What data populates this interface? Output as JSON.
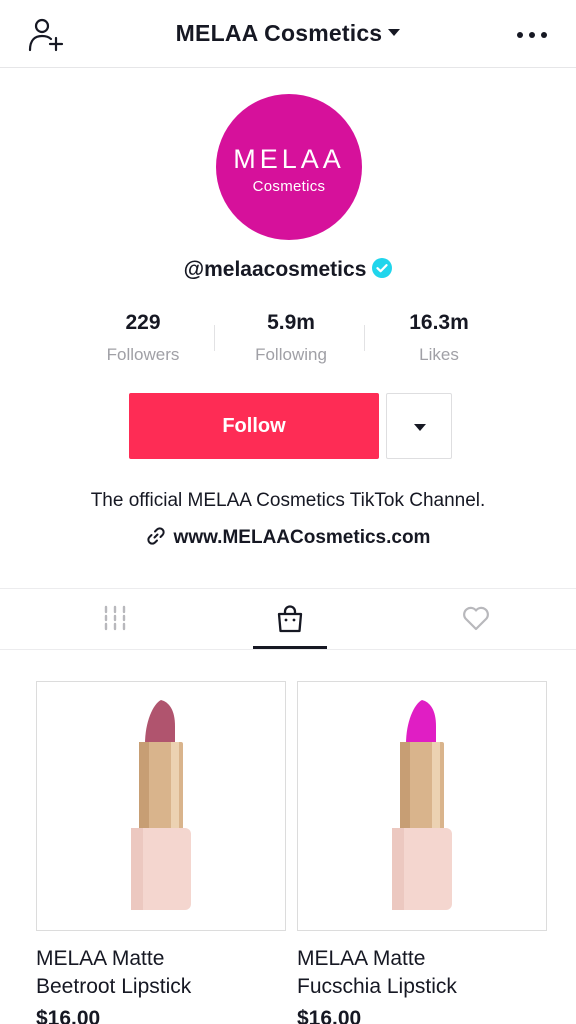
{
  "header": {
    "title": "MELAA Cosmetics",
    "add_user_icon": "add-user-icon",
    "more_icon": "more-dots-icon"
  },
  "profile": {
    "avatar_brand": "MELAA",
    "avatar_sub": "Cosmetics",
    "avatar_color": "#d6119b",
    "handle": "@melaacosmetics",
    "verified_icon": "verified-check-icon",
    "verified_color": "#20d5ec"
  },
  "stats": [
    {
      "value": "229",
      "label": "Followers"
    },
    {
      "value": "5.9m",
      "label": "Following"
    },
    {
      "value": "16.3m",
      "label": "Likes"
    }
  ],
  "actions": {
    "follow_label": "Follow",
    "follow_color": "#fe2c55",
    "dropdown_icon": "caret-down-icon"
  },
  "bio": {
    "text": "The official MELAA Cosmetics TikTok Channel.",
    "link_icon": "link-icon",
    "link": "www.MELAACosmetics.com"
  },
  "tabs": [
    {
      "icon": "videos-grid-icon",
      "active": false
    },
    {
      "icon": "shop-bag-icon",
      "active": true
    },
    {
      "icon": "liked-heart-icon",
      "active": false
    }
  ],
  "products": [
    {
      "title_line1": "MELAA Matte",
      "title_line2": "Beetroot Lipstick",
      "price": "$16.00",
      "lipstick_color": "#b0546e"
    },
    {
      "title_line1": "MELAA Matte",
      "title_line2": "Fucschia Lipstick",
      "price": "$16.00",
      "lipstick_color": "#e01ec4"
    }
  ]
}
